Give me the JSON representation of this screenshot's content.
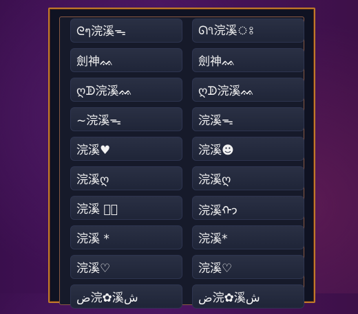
{
  "names": [
    {
      "left": "ᘓๆ浣溪ᯓ",
      "right": "ᘏ૧浣溪ঃ"
    },
    {
      "left": "劍神ᨐ",
      "right": "劍神ᨐ"
    },
    {
      "left": "ღᗫ浣溪ᨐ",
      "right": "ღᗫ浣溪ᨐ"
    },
    {
      "left": "~浣溪ᯓ",
      "right": "浣溪ᯓ"
    },
    {
      "left": "浣溪♥",
      "right": "浣溪☻"
    },
    {
      "left": "浣溪ღ",
      "right": "浣溪ღ"
    },
    {
      "left": "浣溪 ᡃ⃝",
      "right": "浣溪ᡣ𐭩"
    },
    {
      "left": "浣溪 *",
      "right": "浣溪*"
    },
    {
      "left": "浣溪♡",
      "right": "浣溪♡"
    },
    {
      "left": "ض浣✿溪ش",
      "right": "ض浣✿溪ش"
    }
  ]
}
